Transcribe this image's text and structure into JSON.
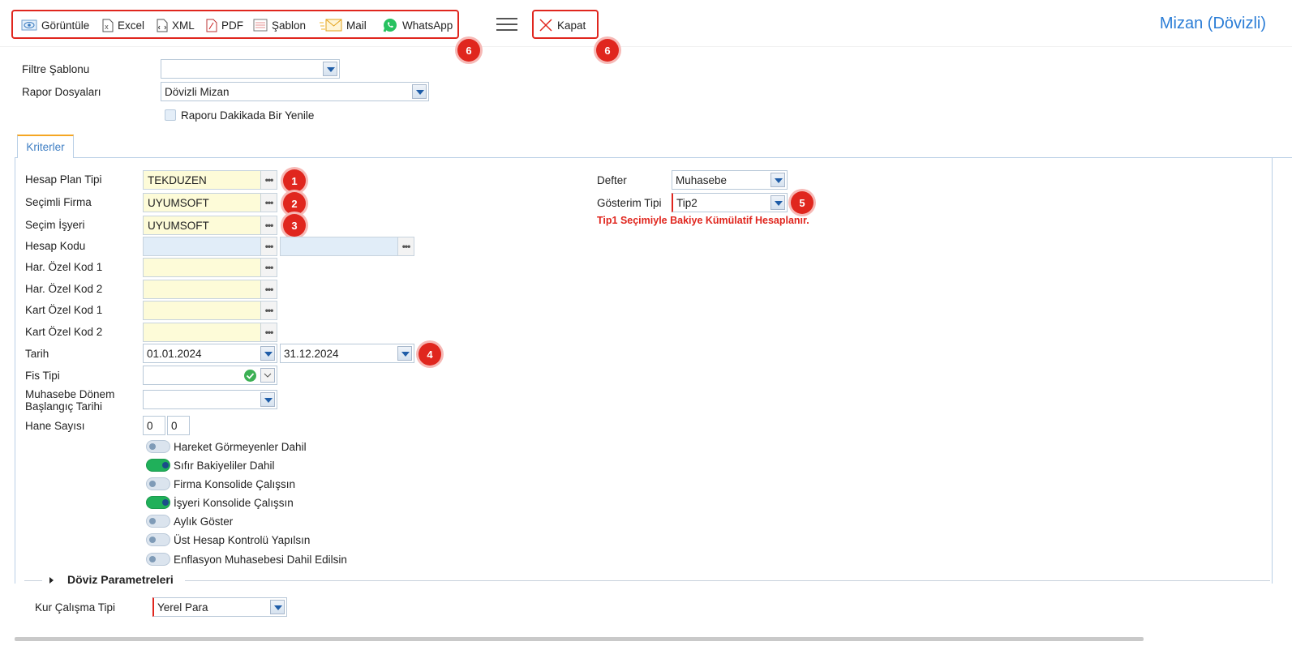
{
  "toolbar": {
    "view_label": "Görüntüle",
    "excel_label": "Excel",
    "xml_label": "XML",
    "pdf_label": "PDF",
    "template_label": "Şablon",
    "mail_label": "Mail",
    "whatsapp_label": "WhatsApp",
    "close_label": "Kapat"
  },
  "page_title": "Mizan (Dövizli)",
  "badges": {
    "b1": "1",
    "b2": "2",
    "b3": "3",
    "b4": "4",
    "b5": "5",
    "b6": "6"
  },
  "filters": {
    "filter_template_label": "Filtre Şablonu",
    "filter_template_value": "",
    "report_files_label": "Rapor Dosyaları",
    "report_files_value": "Dövizli Mizan",
    "refresh_label": "Raporu Dakikada Bir Yenile"
  },
  "tabs": {
    "criteria": "Kriterler"
  },
  "criteria": {
    "plan_type_label": "Hesap Plan Tipi",
    "plan_type_value": "TEKDUZEN",
    "firm_label": "Seçimli Firma",
    "firm_value": "UYUMSOFT",
    "workplace_label": "Seçim İşyeri",
    "workplace_value": "UYUMSOFT",
    "account_code_label": "Hesap Kodu",
    "har_code1_label": "Har. Özel Kod 1",
    "har_code2_label": "Har. Özel Kod 2",
    "card_code1_label": "Kart Özel Kod 1",
    "card_code2_label": "Kart Özel Kod 2",
    "date_label": "Tarih",
    "date_start": "01.01.2024",
    "date_end": "31.12.2024",
    "voucher_type_label": "Fis Tipi",
    "period_start_label_1": "Muhasebe Dönem",
    "period_start_label_2": "Başlangıç Tarihi",
    "digits_label": "Hane Sayısı",
    "digits_a": "0",
    "digits_b": "0",
    "ledger_label": "Defter",
    "ledger_value": "Muhasebe",
    "display_type_label": "Gösterim Tipi",
    "display_type_value": "Tip2",
    "display_note": "Tip1 Seçimiyle Bakiye Kümülatif Hesaplanır."
  },
  "toggles": [
    {
      "label": "Hareket Görmeyenler Dahil",
      "on": false
    },
    {
      "label": "Sıfır Bakiyeliler Dahil",
      "on": true
    },
    {
      "label": "Firma Konsolide Çalışsın",
      "on": false
    },
    {
      "label": "İşyeri Konsolide Çalışsın",
      "on": true
    },
    {
      "label": "Aylık Göster",
      "on": false
    },
    {
      "label": "Üst Hesap Kontrolü Yapılsın",
      "on": false
    },
    {
      "label": "Enflasyon Muhasebesi Dahil Edilsin",
      "on": false
    }
  ],
  "currency": {
    "section_label": "Döviz Parametreleri",
    "rate_type_label": "Kur Çalışma Tipi",
    "rate_type_value": "Yerel Para"
  },
  "colors": {
    "accent": "#2b7dd6",
    "annotation": "#e0261e",
    "required_field": "#fdfbd8",
    "toggle_on": "#20b05a"
  }
}
